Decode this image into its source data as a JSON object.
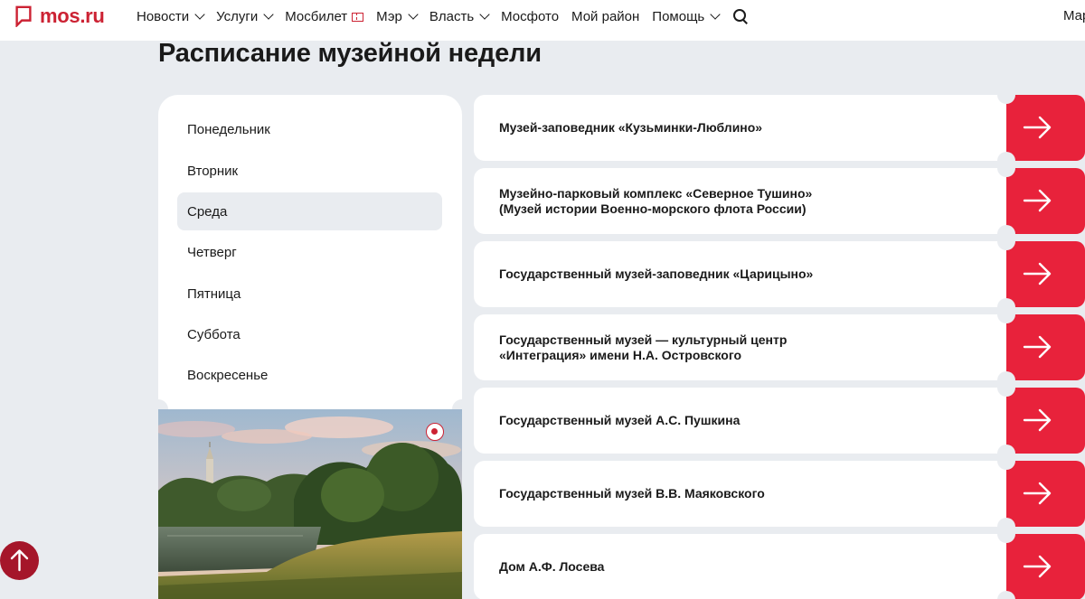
{
  "header": {
    "logo_text": "mos.ru",
    "nav": [
      {
        "label": "Новости",
        "dropdown": true
      },
      {
        "label": "Услуги",
        "dropdown": true
      },
      {
        "label": "Мосбилет",
        "dropdown": false,
        "icon": "ticket-icon"
      },
      {
        "label": "Мэр",
        "dropdown": true
      },
      {
        "label": "Власть",
        "dropdown": true
      },
      {
        "label": "Мосфото",
        "dropdown": false
      },
      {
        "label": "Мой район",
        "dropdown": false
      },
      {
        "label": "Помощь",
        "dropdown": true
      }
    ],
    "search_icon": "search-icon",
    "right_cut_text": "Мар"
  },
  "page_title": "Расписание музейной недели",
  "days": {
    "items": [
      "Понедельник",
      "Вторник",
      "Среда",
      "Четверг",
      "Пятница",
      "Суббота",
      "Воскресенье"
    ],
    "selected": "Среда"
  },
  "museums": [
    "Музей-заповедник «Кузьминки-Люблино»",
    "Музейно-парковый комплекс «Северное Тушино»\n(Музей истории Военно-морского флота России)",
    "Государственный музей-заповедник «Царицыно»",
    "Государственный музей — культурный центр\n«Интеграция» имени Н.А. Островского",
    "Государственный музей А.С. Пушкина",
    "Государственный музей В.В. Маяковского",
    "Дом А.Ф. Лосева"
  ],
  "colors": {
    "brand_red": "#cc2233",
    "arrow_red": "#e8223b",
    "scroll_button": "#a5162a",
    "page_bg": "#e9ecf0"
  }
}
